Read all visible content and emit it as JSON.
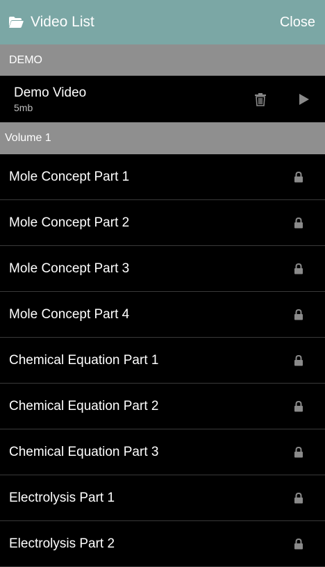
{
  "app_bar": {
    "icon": "folder-open-icon",
    "title": "Video List",
    "close_label": "Close",
    "background": "#7ba7a5"
  },
  "sections": [
    {
      "header": "DEMO",
      "demo_item": {
        "title": "Demo Video",
        "size": "5mb",
        "actions": [
          "trash-icon",
          "play-icon"
        ]
      }
    },
    {
      "header": "Volume 1",
      "items": [
        {
          "label": "Mole Concept Part 1",
          "icon": "lock-icon"
        },
        {
          "label": "Mole Concept Part 2",
          "icon": "lock-icon"
        },
        {
          "label": "Mole Concept Part 3",
          "icon": "lock-icon"
        },
        {
          "label": "Mole Concept Part 4",
          "icon": "lock-icon"
        },
        {
          "label": "Chemical Equation Part 1",
          "icon": "lock-icon"
        },
        {
          "label": "Chemical Equation Part 2",
          "icon": "lock-icon"
        },
        {
          "label": "Chemical Equation Part 3",
          "icon": "lock-icon"
        },
        {
          "label": "Electrolysis Part 1",
          "icon": "lock-icon"
        },
        {
          "label": "Electrolysis Part 2",
          "icon": "lock-icon"
        }
      ]
    }
  ],
  "colors": {
    "section_header_bg": "#8f8f8f",
    "list_bg": "#000000",
    "icon_gray": "#8a8a8a"
  }
}
